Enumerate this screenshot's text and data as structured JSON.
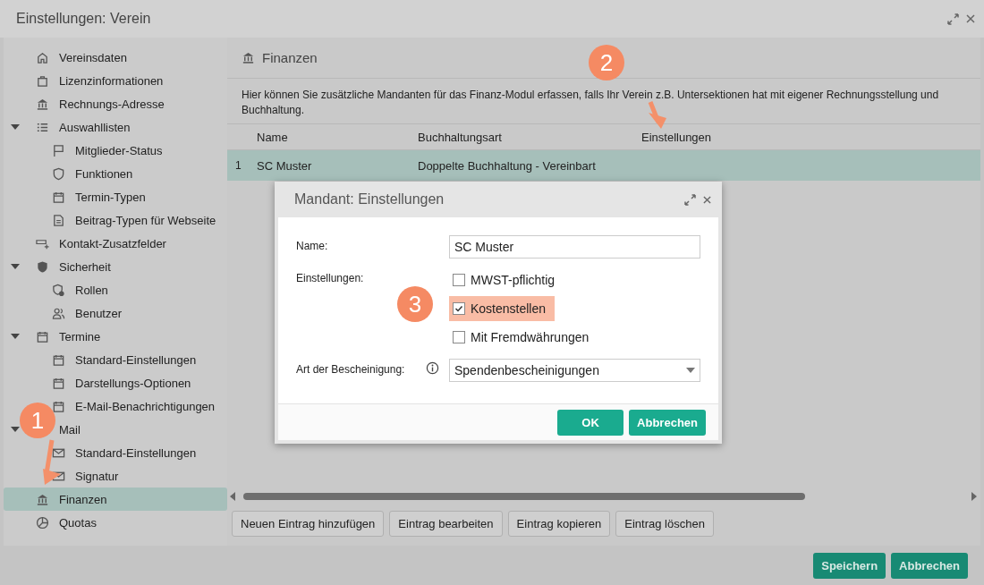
{
  "window": {
    "title": "Einstellungen: Verein"
  },
  "sidebar": {
    "items": [
      {
        "label": "Vereinsdaten",
        "selected": false
      },
      {
        "label": "Lizenzinformationen",
        "selected": false
      },
      {
        "label": "Rechnungs-Adresse",
        "selected": false
      },
      {
        "label": "Auswahllisten",
        "selected": false,
        "expanded": true,
        "children": [
          {
            "label": "Mitglieder-Status",
            "selected": false
          },
          {
            "label": "Funktionen",
            "selected": false
          },
          {
            "label": "Termin-Typen",
            "selected": false
          },
          {
            "label": "Beitrag-Typen für Webseite",
            "selected": false
          }
        ]
      },
      {
        "label": "Kontakt-Zusatzfelder",
        "selected": false
      },
      {
        "label": "Sicherheit",
        "selected": false,
        "expanded": true,
        "children": [
          {
            "label": "Rollen",
            "selected": false
          },
          {
            "label": "Benutzer",
            "selected": false
          }
        ]
      },
      {
        "label": "Termine",
        "selected": false,
        "expanded": true,
        "children": [
          {
            "label": "Standard-Einstellungen",
            "selected": false
          },
          {
            "label": "Darstellungs-Optionen",
            "selected": false
          },
          {
            "label": "E-Mail-Benachrichtigungen",
            "selected": false
          }
        ]
      },
      {
        "label": "Mail",
        "selected": false,
        "expanded": true,
        "children": [
          {
            "label": "Standard-Einstellungen",
            "selected": false
          },
          {
            "label": "Signatur",
            "selected": false
          }
        ]
      },
      {
        "label": "Finanzen",
        "selected": true
      },
      {
        "label": "Quotas",
        "selected": false
      }
    ]
  },
  "panel": {
    "title": "Finanzen",
    "description": "Hier können Sie zusätzliche Mandanten für das Finanz-Modul erfassen, falls Ihr Verein z.B. Untersektionen hat mit eigener Rechnungsstellung und Buchhaltung.",
    "table": {
      "columns": [
        "Name",
        "Buchhaltungsart",
        "Einstellungen"
      ],
      "rows": [
        {
          "index": "1",
          "cells": [
            "SC Muster",
            "Doppelte Buchhaltung - Vereinbart"
          ],
          "selected": true
        }
      ]
    },
    "actions": [
      "Neuen Eintrag hinzufügen",
      "Eintrag bearbeiten",
      "Eintrag kopieren",
      "Eintrag löschen"
    ]
  },
  "footer_buttons": [
    "Speichern",
    "Abbrechen"
  ],
  "dialog": {
    "title": "Mandant: Einstellungen",
    "fields": [
      {
        "kind": "text",
        "label": "Name:",
        "value": "SC Muster"
      },
      {
        "kind": "checkboxes",
        "label": "Einstellungen:",
        "options": [
          {
            "label": "MWST-pflichtig",
            "checked": false,
            "highlighted": false
          },
          {
            "label": "Kostenstellen",
            "checked": true,
            "highlighted": true
          },
          {
            "label": "Mit Fremdwährungen",
            "checked": false,
            "highlighted": false
          }
        ]
      },
      {
        "kind": "select",
        "label": "Art der Bescheinigung:",
        "info": true,
        "value": "Spendenbescheinigungen"
      }
    ],
    "buttons": [
      "OK",
      "Abbrechen"
    ]
  },
  "callouts": [
    {
      "number": "1"
    },
    {
      "number": "2"
    },
    {
      "number": "3"
    }
  ]
}
